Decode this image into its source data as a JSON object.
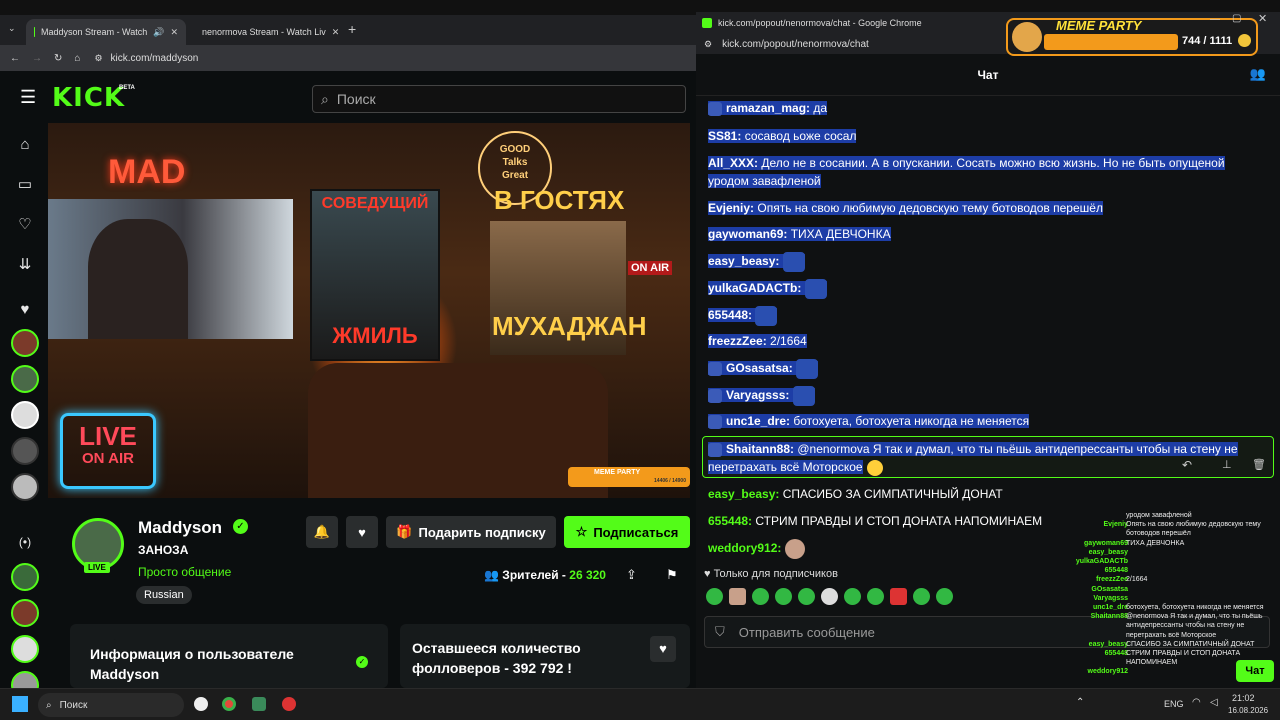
{
  "left_browser": {
    "tabs": [
      {
        "title": "Maddyson Stream - Watch"
      },
      {
        "title": "nenormova Stream - Watch Liv"
      }
    ],
    "url": "kick.com/maddyson"
  },
  "kick": {
    "logo": "KICK",
    "logo_badge": "BETA",
    "search_placeholder": "Поиск"
  },
  "video": {
    "sign_mad": "MAD",
    "poster1_top": "СОВЕДУЩИЙ",
    "poster1_bottom": "ЖМИЛЬ",
    "good_talks": [
      "GOOD",
      "Talks",
      "Great"
    ],
    "poster2_top": "В ГОСТЯХ",
    "poster2_bottom": "МУХАДЖАН",
    "on_air_small": "ON AIR",
    "live_line1": "LIVE",
    "live_line2": "ON AIR",
    "meme_mini": "MEME PARTY",
    "meme_mini_count": "14406 / 14900"
  },
  "channel": {
    "name": "Maddyson",
    "title": "ЗАНОЗА",
    "category": "Просто общение",
    "tag": "Russian",
    "live_badge": "LIVE",
    "gift_label": "Подарить подписку",
    "subscribe_label": "Подписаться",
    "viewers_label": "Зрителей -",
    "viewers_count": "26 320",
    "about_card": "Информация о пользователе Maddyson",
    "followers_card": "Оставшееся количество фолловеров - 392 792 !"
  },
  "chat_window": {
    "title": "kick.com/popout/nenormova/chat - Google Chrome",
    "url": "kick.com/popout/nenormova/chat",
    "header": "Чат",
    "messages": [
      {
        "user": "ramazan_mag:",
        "text": "да",
        "user_color": "#ffffff"
      },
      {
        "user": "SS81:",
        "text": "сосавод ьоже сосал",
        "user_color": "#ffffff"
      },
      {
        "user": "All_XXX:",
        "text": "Дело не в сосании. А в опускании. Сосать можно всю жизнь. Но не быть опущеной",
        "text2": "уродом завафленой",
        "user_color": "#ffffff"
      },
      {
        "user": "Evjeniy:",
        "text": "Опять на свою любимую дедовскую тему ботоводов перешёл",
        "user_color": "#ffffff"
      },
      {
        "user": "gaywoman69:",
        "text": "ТИХА ДЕВЧОНКА",
        "user_color": "#ffffff"
      },
      {
        "user": "easy_beasy:",
        "text": "",
        "user_color": "#ffffff"
      },
      {
        "user": "yulkaGADACTb:",
        "text": "",
        "user_color": "#ffffff"
      },
      {
        "user": "655448:",
        "text": "",
        "user_color": "#ffffff"
      },
      {
        "user": "freezzZee:",
        "text": "2/1664",
        "user_color": "#ffffff"
      },
      {
        "user": "GOsasatsa:",
        "text": "",
        "user_color": "#ffffff"
      },
      {
        "user": "Varyagsss:",
        "text": "",
        "user_color": "#ffffff"
      },
      {
        "user": "unc1e_dre:",
        "text": "ботохуета, ботохуета никогда не меняется",
        "user_color": "#ffffff"
      },
      {
        "user": "Shaitann88:",
        "text": "@nenormova Я так и думал, что ты пьёшь антидепрессанты чтобы на стену не",
        "text2": "перетрахать всё Моторское",
        "user_color": "#ffffff"
      },
      {
        "user": "easy_beasy:",
        "text": "СПАСИБО ЗА СИМПАТИЧНЫЙ ДОНАТ",
        "user_color": "#53fc18"
      },
      {
        "user": "655448:",
        "text": "СТРИМ ПРАВДЫ И СТОП ДОНАТА НАПОМИНАЕМ",
        "user_color": "#53fc18"
      },
      {
        "user": "weddory912:",
        "text": "",
        "user_color": "#53fc18"
      }
    ],
    "subscribers_only": "Только для подписчиков",
    "input_placeholder": "Отправить сообщение"
  },
  "meme_party": {
    "label": "MEME PARTY",
    "count": "744 / 1111"
  },
  "overlay_chat": [
    {
      "user": "",
      "text": "уродом завафленой"
    },
    {
      "user": "Evjeniy",
      "text": "Опять на свою любимую дедовскую тему"
    },
    {
      "user": "",
      "text": "ботоводов перешёл"
    },
    {
      "user": "gaywoman69",
      "text": "ТИХА ДЕВЧОНКА"
    },
    {
      "user": "easy_beasy",
      "text": ""
    },
    {
      "user": "yulkaGADACTb",
      "text": ""
    },
    {
      "user": "655448",
      "text": ""
    },
    {
      "user": "freezzZee",
      "text": "2/1664"
    },
    {
      "user": "GOsasatsa",
      "text": ""
    },
    {
      "user": "Varyagsss",
      "text": ""
    },
    {
      "user": "unc1e_dre",
      "text": "ботохуета, ботохуета никогда не меняется"
    },
    {
      "user": "Shaitann88",
      "text": "@nenormova Я так и думал, что ты пьёшь"
    },
    {
      "user": "",
      "text": "антидепрессанты чтобы на стену не"
    },
    {
      "user": "",
      "text": "перетрахать всё Моторское"
    },
    {
      "user": "easy_beasy",
      "text": "СПАСИБО ЗА СИМПАТИЧНЫЙ ДОНАТ"
    },
    {
      "user": "655448",
      "text": "СТРИМ ПРАВДЫ И СТОП ДОНАТА"
    },
    {
      "user": "",
      "text": "НАПОМИНАЕМ"
    },
    {
      "user": "weddory912",
      "text": ""
    }
  ],
  "overlay_chat_button": "Чат",
  "taskbar": {
    "search_label": "Поиск",
    "lang": "ENG",
    "time": "21:02",
    "date": "16.08.2026"
  }
}
